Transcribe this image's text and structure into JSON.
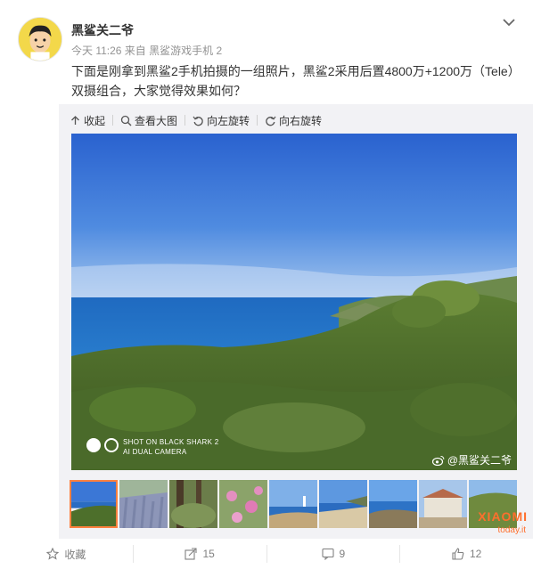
{
  "post": {
    "author": "黑鲨关二爷",
    "meta_time": "今天 11:26 来自",
    "meta_source": "黑鲨游戏手机 2",
    "text": "下面是刚拿到黑鲨2手机拍摄的一组照片，黑鲨2采用后置4800万+1200万（Tele）双摄组合，大家觉得效果如何？"
  },
  "toolbar": {
    "collapse": "收起",
    "view_large": "查看大图",
    "rotate_left": "向左旋转",
    "rotate_right": "向右旋转"
  },
  "photo": {
    "shot_line1": "SHOT ON BLACK SHARK 2",
    "shot_line2": "AI DUAL CAMERA",
    "watermark": "@黑鲨关二爷"
  },
  "thumbnails": [
    "coast",
    "lavender",
    "trees",
    "pink-flowers",
    "lighthouse",
    "beach",
    "bay",
    "building",
    "hillside"
  ],
  "actions": {
    "favorite": "收藏",
    "repost_count": "15",
    "comment_count": "9",
    "like_count": "12"
  },
  "site_logo": {
    "brand": "XIAOMI",
    "sub": "today.it"
  },
  "colors": {
    "accent": "#ff8140",
    "muted_text": "#939393",
    "media_bg": "#f2f2f5"
  }
}
